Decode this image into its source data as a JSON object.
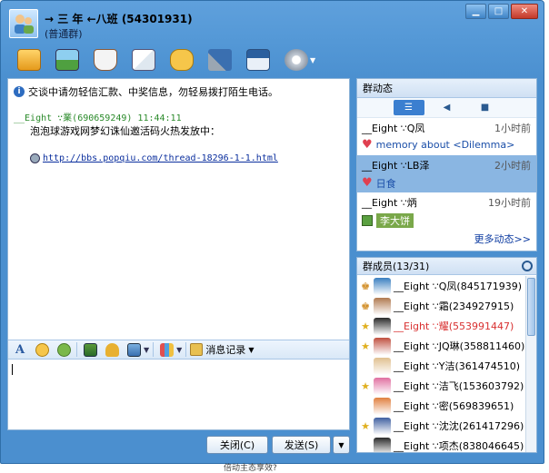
{
  "window": {
    "title": "→ 三 年 ←八班 (54301931)",
    "subtitle": "(普通群)",
    "controls": [
      "minimize-icon",
      "maximize-icon",
      "close-icon"
    ]
  },
  "toolbar": {
    "tools": [
      "folder-icon",
      "photo-icon",
      "coffee-cup-icon",
      "mail-icon",
      "chat-bubble-icon",
      "tools-icon",
      "member-card-icon",
      "settings-icon"
    ]
  },
  "chat": {
    "notice": "交谈中请勿轻信汇款、中奖信息，勿轻易拨打陌生电话。",
    "message": {
      "header": "__Eight ∵業(690659249)  11:44:11",
      "body": "泡泡球游戏网梦幻诛仙邀活码火热发放中：",
      "link": "http://bbs.popqiu.com/thread-18296-1-1.html"
    },
    "input_tools": [
      "font-icon",
      "smiley-icon",
      "emoji-magic-icon",
      "screenshot-icon",
      "music-icon",
      "screen-share-icon",
      "more-apps-icon"
    ],
    "history_label": "消息记录",
    "input_value": ""
  },
  "buttons": {
    "close_label": "关闭(C)",
    "send_label": "发送(S)"
  },
  "dynamics": {
    "title": "群动态",
    "items": [
      {
        "name": "__Eight ∵Q凤",
        "time": "1小时前",
        "text": "memory about <Dilemma>",
        "icon": "heart"
      },
      {
        "name": "__Eight ∵LB泽",
        "time": "2小时前",
        "text": "日食",
        "icon": "heart"
      },
      {
        "name": "__Eight ∵炳",
        "time": "19小时前",
        "text": "李大饼",
        "icon": "picture"
      }
    ],
    "more_label": "更多动态>>"
  },
  "members": {
    "title": "群成员(13/31)",
    "list": [
      {
        "role": "owner",
        "text": "__Eight ∵Q凤(845171939)",
        "color": "#000000",
        "avatar": "#3a7fc0"
      },
      {
        "role": "owner",
        "text": "__Eight ∵霜(234927915)",
        "color": "#000000",
        "avatar": "#b07a50"
      },
      {
        "role": "admin",
        "text": "__Eight ∵耀(553991447)",
        "color": "#d83030",
        "avatar": "#2a2a2a"
      },
      {
        "role": "admin",
        "text": "__Eight ∵JQ琳(358811460)",
        "color": "#000000",
        "avatar": "#c05040"
      },
      {
        "role": "",
        "text": "__Eight ∵Y洁(361474510)",
        "color": "#000000",
        "avatar": "#e0c090"
      },
      {
        "role": "admin",
        "text": "__Eight ∵洁飞(153603792)",
        "color": "#000000",
        "avatar": "#e070a0"
      },
      {
        "role": "",
        "text": "__Eight ∵密(569839651)",
        "color": "#000000",
        "avatar": "#e08040"
      },
      {
        "role": "admin",
        "text": "__Eight ∵沈沈(261417296)",
        "color": "#000000",
        "avatar": "#4060a0"
      },
      {
        "role": "",
        "text": "__Eight ∵项杰(838046645)",
        "color": "#000000",
        "avatar": "#2a2a2a"
      }
    ]
  },
  "footer_fragment": "倍动主态享效?"
}
